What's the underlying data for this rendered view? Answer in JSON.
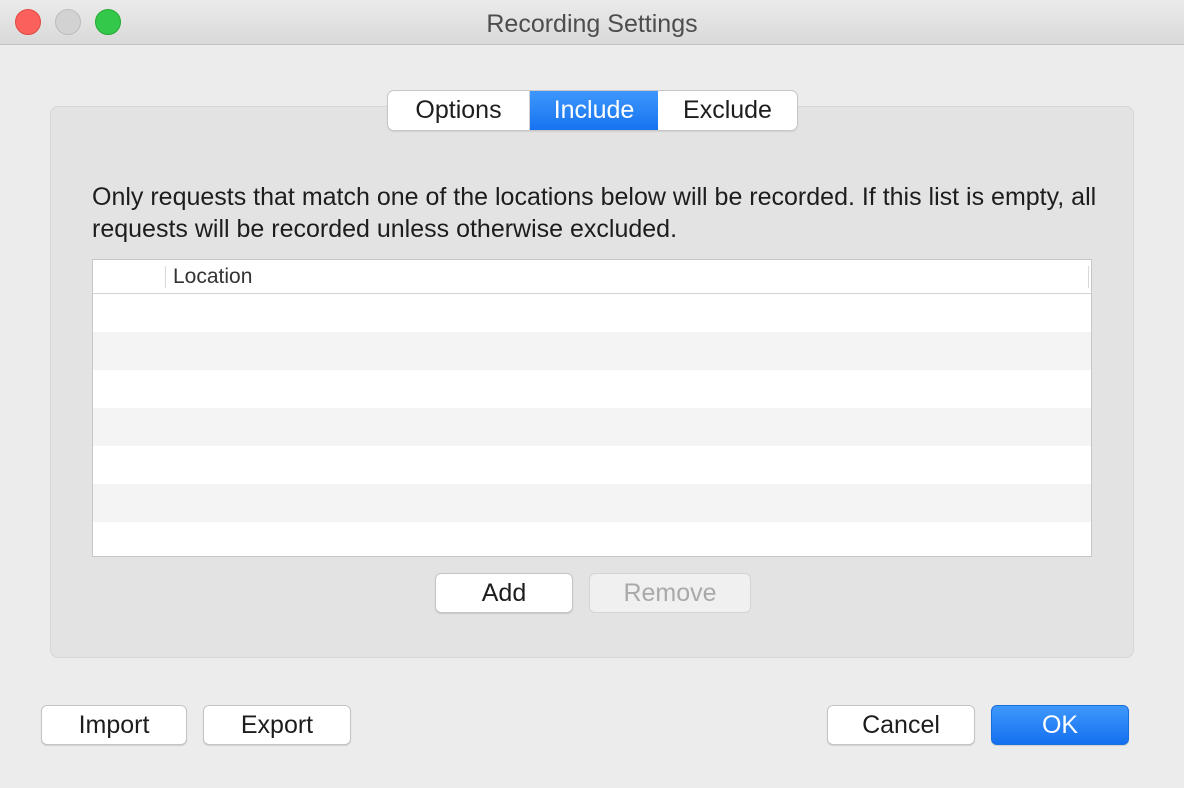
{
  "window": {
    "title": "Recording Settings"
  },
  "tabs": [
    {
      "label": "Options",
      "active": false
    },
    {
      "label": "Include",
      "active": true
    },
    {
      "label": "Exclude",
      "active": false
    }
  ],
  "include": {
    "description": "Only requests that match one of the locations below will be recorded. If this list is empty, all requests will be recorded unless otherwise excluded.",
    "table": {
      "columns": [
        "",
        "Location"
      ],
      "rows": []
    },
    "add_label": "Add",
    "remove_label": "Remove"
  },
  "footer": {
    "import_label": "Import",
    "export_label": "Export",
    "cancel_label": "Cancel",
    "ok_label": "OK"
  },
  "colors": {
    "accent": "#1773f0",
    "close": "#fc605c",
    "minimize": "#d2d2d2",
    "zoom": "#34c84a"
  }
}
